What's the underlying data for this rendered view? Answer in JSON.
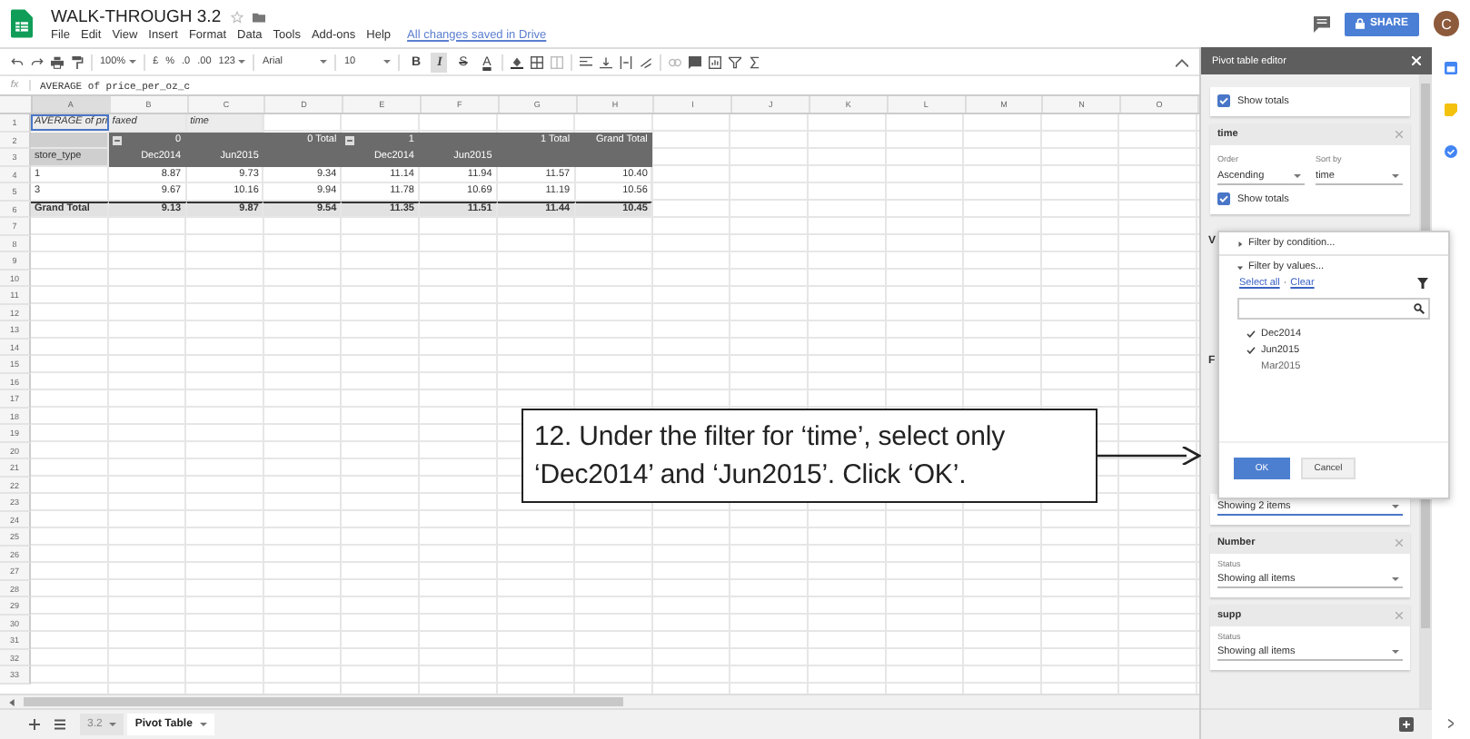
{
  "doc": {
    "title": "WALK-THROUGH 3.2",
    "menu": [
      "File",
      "Edit",
      "View",
      "Insert",
      "Format",
      "Data",
      "Tools",
      "Add-ons",
      "Help"
    ],
    "save_status": "All changes saved in Drive",
    "share_label": "SHARE",
    "avatar_initial": "C"
  },
  "toolbar": {
    "zoom": "100%",
    "currency": "£",
    "percent": "%",
    "decrease_decimals": ".0",
    "increase_decimals": ".00",
    "number_format": "123",
    "font": "Arial",
    "font_size": "10",
    "format_buttons": [
      {
        "label": "B",
        "kind": "bold",
        "selected": false
      },
      {
        "label": "I",
        "kind": "italic",
        "selected": true
      },
      {
        "label": "S",
        "kind": "strike",
        "selected": false
      },
      {
        "label": "A",
        "kind": "color",
        "selected": false
      }
    ]
  },
  "formula_bar": {
    "label": "fx",
    "value": "AVERAGE of price_per_oz_c"
  },
  "sheet": {
    "columns": [
      "A",
      "B",
      "C",
      "D",
      "E",
      "F",
      "G",
      "H",
      "I",
      "J",
      "K",
      "L",
      "M",
      "N",
      "O"
    ],
    "row_numbers": [
      "1",
      "2",
      "3",
      "4",
      "5",
      "6",
      "7",
      "8",
      "9",
      "10",
      "11",
      "12",
      "13",
      "14",
      "15",
      "16",
      "17",
      "18",
      "19",
      "20",
      "21",
      "22",
      "23",
      "24",
      "25",
      "26",
      "27",
      "28",
      "29",
      "30",
      "31",
      "32",
      "33"
    ],
    "rows": [
      {
        "kind": "field_labels",
        "cells": [
          {
            "text": "AVERAGE of pri",
            "selected": true
          },
          {
            "text": "faxed",
            "selected": false
          },
          {
            "text": "time",
            "selected": false
          },
          null,
          null,
          null,
          null,
          null
        ]
      },
      {
        "kind": "column_header",
        "cells": [
          {
            "text": null,
            "selected": false
          },
          {
            "text": "0",
            "toggle": true,
            "selected": false
          },
          null,
          {
            "text": "0 Total",
            "selected": false
          },
          {
            "text": "1",
            "toggle": true,
            "selected": false
          },
          null,
          {
            "text": "1 Total",
            "selected": false
          },
          {
            "text": "Grand Total",
            "selected": false
          }
        ]
      },
      {
        "kind": "column_header",
        "cells": [
          {
            "text": "store_type",
            "selected": false
          },
          {
            "text": "Dec2014",
            "selected": false
          },
          {
            "text": "Jun2015",
            "selected": false
          },
          null,
          {
            "text": "Dec2014",
            "selected": false
          },
          {
            "text": "Jun2015",
            "selected": false
          },
          null,
          null
        ]
      },
      {
        "kind": "data",
        "cells": [
          {
            "text": "1",
            "selected": false
          },
          {
            "text": "8.87",
            "selected": false
          },
          {
            "text": "9.73",
            "selected": false
          },
          {
            "text": "9.34",
            "selected": false
          },
          {
            "text": "11.14",
            "selected": false
          },
          {
            "text": "11.94",
            "selected": false
          },
          {
            "text": "11.57",
            "selected": false
          },
          {
            "text": "10.40",
            "selected": false
          }
        ]
      },
      {
        "kind": "data",
        "cells": [
          {
            "text": "3",
            "selected": false
          },
          {
            "text": "9.67",
            "selected": false
          },
          {
            "text": "10.16",
            "selected": false
          },
          {
            "text": "9.94",
            "selected": false
          },
          {
            "text": "11.78",
            "selected": false
          },
          {
            "text": "10.69",
            "selected": false
          },
          {
            "text": "11.19",
            "selected": false
          },
          {
            "text": "10.56",
            "selected": false
          }
        ]
      },
      {
        "kind": "grand_total",
        "cells": [
          {
            "text": "Grand Total",
            "selected": false
          },
          {
            "text": "9.13",
            "selected": false
          },
          {
            "text": "9.87",
            "selected": false
          },
          {
            "text": "9.54",
            "selected": false
          },
          {
            "text": "11.35",
            "selected": false
          },
          {
            "text": "11.51",
            "selected": false
          },
          {
            "text": "11.44",
            "selected": false
          },
          {
            "text": "10.45",
            "selected": false
          }
        ]
      }
    ]
  },
  "sheet_tabs": [
    {
      "label": "3.2",
      "selected": false
    },
    {
      "label": "Pivot Table",
      "selected": true
    }
  ],
  "pivot_editor": {
    "title": "Pivot table editor",
    "cards": [
      {
        "kind": "totals",
        "show_totals": true,
        "totals_label": "Show totals"
      },
      {
        "kind": "group",
        "name": "time",
        "order_label": "Order",
        "order": "Ascending",
        "sort_label": "Sort by",
        "sort_by": "time",
        "show_totals": true,
        "totals_label": "Show totals"
      }
    ],
    "section_headings": [
      "V",
      "F"
    ],
    "filters": [
      {
        "status": "Showing 2 items",
        "active": true
      },
      {
        "name": "Number",
        "status_label": "Status",
        "status": "Showing all items",
        "active": false
      },
      {
        "name": "supp",
        "status_label": "Status",
        "status": "Showing all items",
        "active": false
      }
    ]
  },
  "filter_popup": {
    "sections": [
      {
        "label": "Filter by condition...",
        "expanded": false
      },
      {
        "label": "Filter by values...",
        "expanded": true
      }
    ],
    "select_all": "Select all",
    "separator": "·",
    "clear": "Clear",
    "values": [
      {
        "label": "Dec2014",
        "checked": true
      },
      {
        "label": "Jun2015",
        "checked": true
      },
      {
        "label": "Mar2015",
        "checked": false
      }
    ],
    "ok": "OK",
    "cancel": "Cancel"
  },
  "callout": {
    "text": "12. Under the filter for ‘time’, select only ‘Dec2014’ and ‘Jun2015’. Click ‘OK’."
  }
}
